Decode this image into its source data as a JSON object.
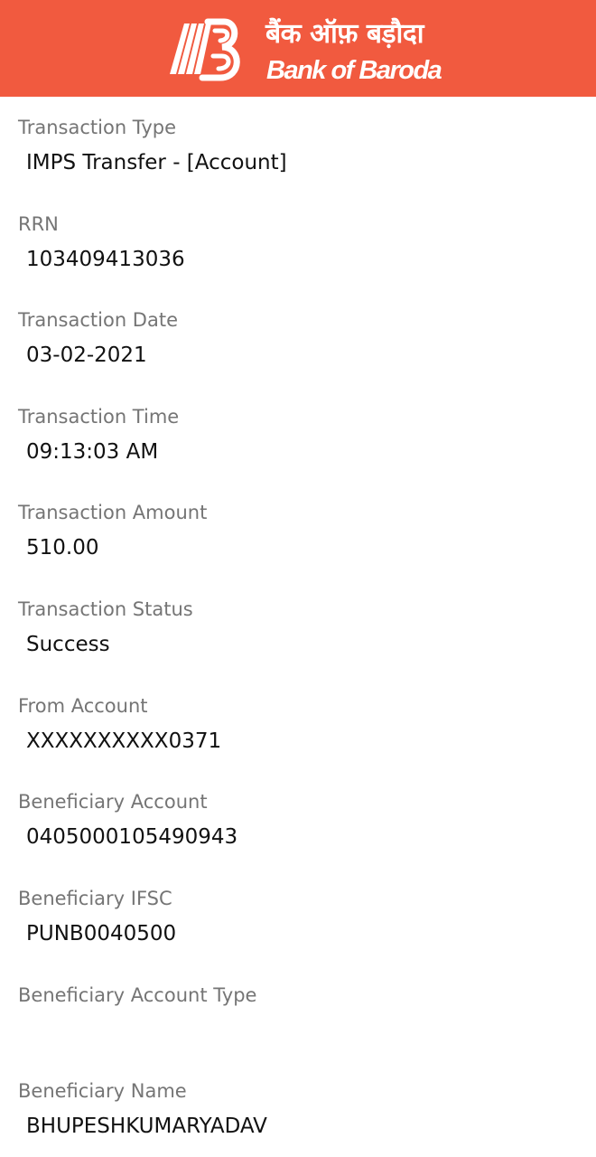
{
  "colors": {
    "header_bg": "#f15a3f",
    "label": "#757575",
    "value": "#111111",
    "logo_white": "#ffffff"
  },
  "header": {
    "logo_icon": "bank-of-baroda-sunrise-logo-icon",
    "brand_hindi": "बैंक ऑफ़ बड़ौदा",
    "brand_english": "Bank of Baroda"
  },
  "fields": [
    {
      "label": "Transaction Type",
      "value": "IMPS Transfer - [Account]"
    },
    {
      "label": "RRN",
      "value": "103409413036"
    },
    {
      "label": "Transaction Date",
      "value": "03-02-2021"
    },
    {
      "label": "Transaction Time",
      "value": "09:13:03 AM"
    },
    {
      "label": "Transaction Amount",
      "value": "510.00"
    },
    {
      "label": "Transaction Status",
      "value": "Success"
    },
    {
      "label": "From Account",
      "value": "XXXXXXXXXX0371"
    },
    {
      "label": "Beneficiary Account",
      "value": "0405000105490943"
    },
    {
      "label": "Beneficiary IFSC",
      "value": "PUNB0040500"
    },
    {
      "label": "Beneficiary Account Type",
      "value": ""
    },
    {
      "label": "Beneficiary Name",
      "value": "BHUPESHKUMARYADAV"
    }
  ]
}
